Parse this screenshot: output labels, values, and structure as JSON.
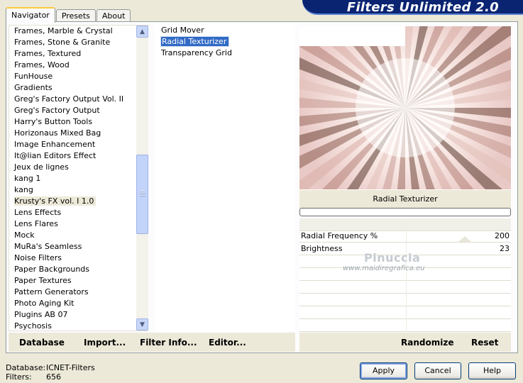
{
  "tabs": [
    "Navigator",
    "Presets",
    "About"
  ],
  "brand": "Filters Unlimited 2.0",
  "categories": [
    "Frames, Marble & Crystal",
    "Frames, Stone & Granite",
    "Frames, Textured",
    "Frames, Wood",
    "FunHouse",
    "Gradients",
    "Greg's Factory Output Vol. II",
    "Greg's Factory Output",
    "Harry's Button Tools",
    "Horizonaus Mixed Bag",
    "Image Enhancement",
    "It@lian Editors Effect",
    "Jeux de lignes",
    "kang 1",
    "kang",
    "Krusty's FX vol. I 1.0",
    "Lens Effects",
    "Lens Flares",
    "Mock",
    "MuRa's Seamless",
    "Noise Filters",
    "Paper Backgrounds",
    "Paper Textures",
    "Pattern Generators",
    "Photo Aging Kit",
    "Plugins AB 07",
    "Psychosis"
  ],
  "selected_category": "Krusty's FX vol. I 1.0",
  "filters": [
    "Grid Mover",
    "Radial Texturizer",
    "Transparency Grid"
  ],
  "selected_filter": "Radial Texturizer",
  "preview_title": "Radial Texturizer",
  "sliders": [
    {
      "name": "Radial Frequency %",
      "value": "200"
    },
    {
      "name": "Brightness",
      "value": "23"
    }
  ],
  "watermark": {
    "line1": "Pinuccia",
    "line2": "www.maidiregrafica.eu"
  },
  "actions": {
    "database": "Database",
    "import": "Import...",
    "filter_info": "Filter Info...",
    "editor": "Editor...",
    "randomize": "Randomize",
    "reset": "Reset"
  },
  "status": {
    "database_label": "Database:",
    "database_value": "ICNET-Filters",
    "filters_label": "Filters:",
    "filters_value": "656"
  },
  "buttons": {
    "apply": "Apply",
    "cancel": "Cancel",
    "help": "Help"
  },
  "colors": {
    "brand": "#0A2472",
    "selection": "#316AC5",
    "face": "#ECE9D8"
  }
}
